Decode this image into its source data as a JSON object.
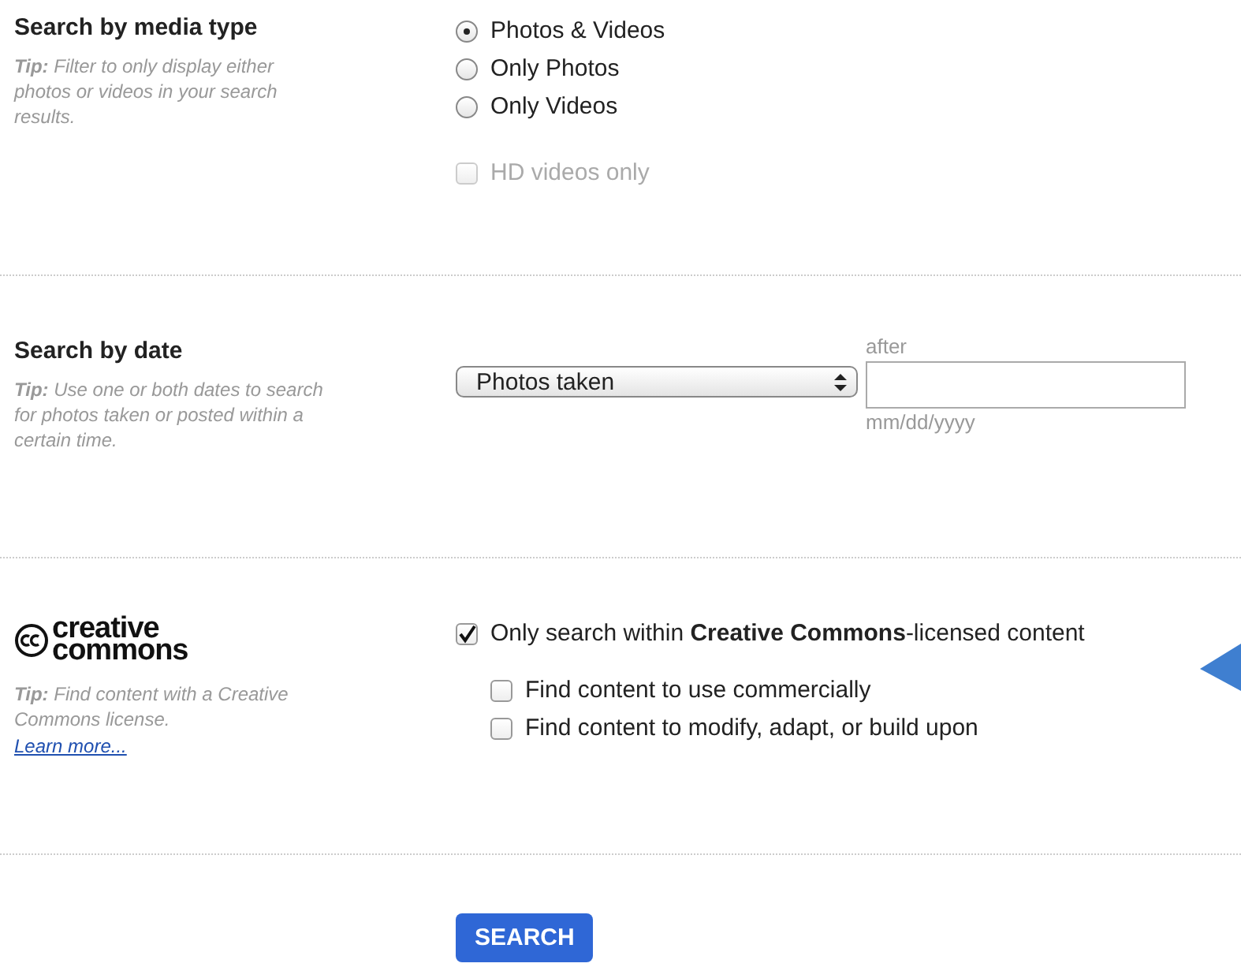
{
  "media": {
    "title": "Search by media type",
    "tip": "**Tip:** Filter to only display either photos or videos in your search results.",
    "options": [
      {
        "label": "Photos & Videos",
        "selected": true
      },
      {
        "label": "Only Photos",
        "selected": false
      },
      {
        "label": "Only Videos",
        "selected": false
      }
    ],
    "hd": {
      "label": "HD videos only",
      "checked": false,
      "disabled": true
    }
  },
  "date": {
    "title": "Search by date",
    "tip": "**Tip:** Use one or both dates to search for photos taken or posted within a certain time.",
    "select": "Photos taken",
    "field_label": "after",
    "field_hint": "mm/dd/yyyy"
  },
  "cc": {
    "logo": [
      "creative",
      "commons"
    ],
    "tip": "**Tip:** Find content with a Creative Commons license.",
    "link": "Learn more...",
    "main": {
      "label": "Only search within **Creative Commons**-licensed content",
      "checked": true
    },
    "options": [
      {
        "label": "Find content to use commercially",
        "checked": false
      },
      {
        "label": "Find content to modify, adapt, or build upon",
        "checked": false
      }
    ]
  },
  "button": "SEARCH"
}
